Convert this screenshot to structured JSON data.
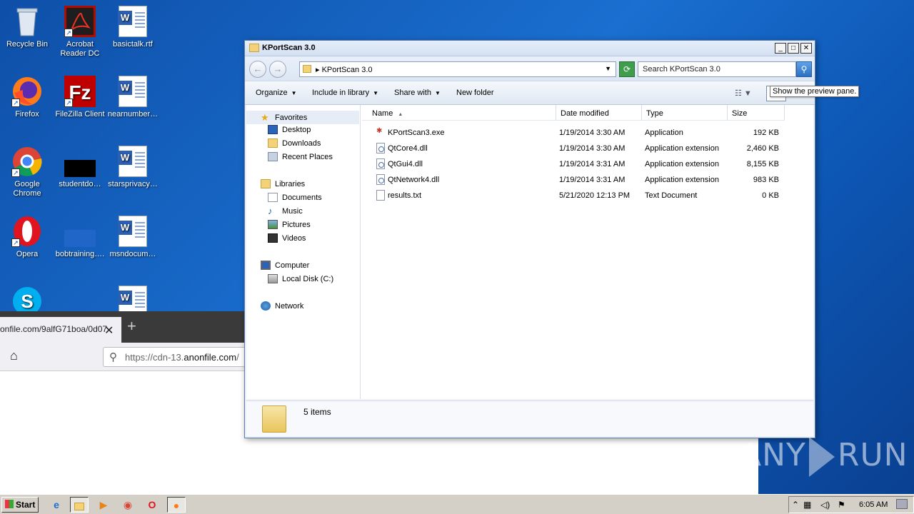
{
  "desktop": {
    "icons": [
      {
        "label": "Recycle Bin"
      },
      {
        "label": "Acrobat Reader DC"
      },
      {
        "label": "basictalk.rtf"
      },
      {
        "label": "Firefox"
      },
      {
        "label": "FileZilla Client"
      },
      {
        "label": "nearnumber…"
      },
      {
        "label": "Google Chrome"
      },
      {
        "label": "studentdo…"
      },
      {
        "label": "starsprivacy…"
      },
      {
        "label": "Opera"
      },
      {
        "label": "bobtraining…."
      },
      {
        "label": "msndocum…"
      }
    ]
  },
  "browser": {
    "tab_title": "onfile.com/9alfG71boa/0d07",
    "tab_close": "✕",
    "new_tab": "+",
    "url_prefix": "https://cdn-13.",
    "url_domain": "anonfile.com",
    "url_suffix": "/"
  },
  "explorer": {
    "title": "KPortScan 3.0",
    "address": "KPortScan 3.0",
    "search_placeholder": "Search KPortScan 3.0",
    "toolbar": {
      "organize": "Organize",
      "include": "Include in library",
      "share": "Share with",
      "new_folder": "New folder"
    },
    "tooltip": "Show the preview pane.",
    "nav": {
      "favorites": "Favorites",
      "desktop": "Desktop",
      "downloads": "Downloads",
      "recent": "Recent Places",
      "libraries": "Libraries",
      "documents": "Documents",
      "music": "Music",
      "pictures": "Pictures",
      "videos": "Videos",
      "computer": "Computer",
      "local_disk": "Local Disk (C:)",
      "network": "Network"
    },
    "columns": {
      "name": "Name",
      "date": "Date modified",
      "type": "Type",
      "size": "Size"
    },
    "files": [
      {
        "name": "KPortScan3.exe",
        "date": "1/19/2014 3:30 AM",
        "type": "Application",
        "size": "192 KB"
      },
      {
        "name": "QtCore4.dll",
        "date": "1/19/2014 3:30 AM",
        "type": "Application extension",
        "size": "2,460 KB"
      },
      {
        "name": "QtGui4.dll",
        "date": "1/19/2014 3:31 AM",
        "type": "Application extension",
        "size": "8,155 KB"
      },
      {
        "name": "QtNetwork4.dll",
        "date": "1/19/2014 3:31 AM",
        "type": "Application extension",
        "size": "983 KB"
      },
      {
        "name": "results.txt",
        "date": "5/21/2020 12:13 PM",
        "type": "Text Document",
        "size": "0 KB"
      }
    ],
    "status": "5 items"
  },
  "watermark": {
    "left": "ANY",
    "right": "RUN"
  },
  "taskbar": {
    "start": "Start",
    "clock": "6:05 AM"
  }
}
